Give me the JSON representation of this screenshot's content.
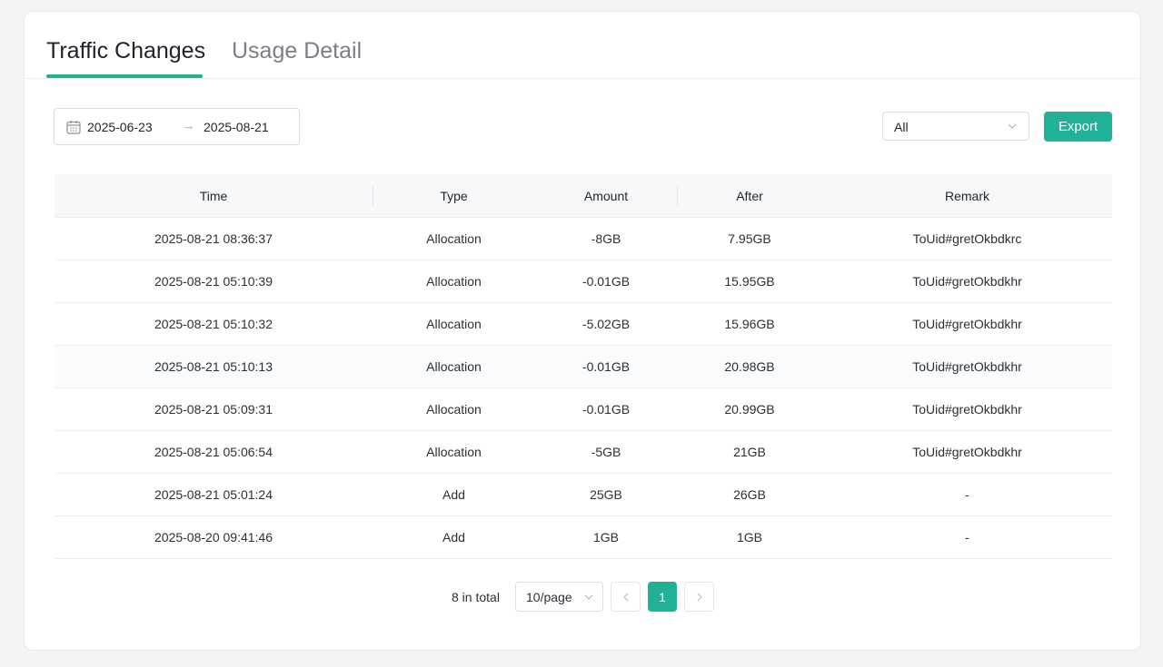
{
  "tabs": [
    {
      "label": "Traffic Changes",
      "active": true
    },
    {
      "label": "Usage Detail",
      "active": false
    }
  ],
  "filters": {
    "date_start": "2025-06-23",
    "date_arrow": "→",
    "date_end": "2025-08-21",
    "type_select": "All",
    "export_label": "Export",
    "icons": {
      "calendar": "calendar-icon",
      "dropdown": "chevron-down-icon"
    }
  },
  "table": {
    "columns": [
      "Time",
      "Type",
      "Amount",
      "After",
      "Remark"
    ],
    "rows": [
      {
        "time": "2025-08-21 08:36:37",
        "type": "Allocation",
        "amount": "-8GB",
        "after": "7.95GB",
        "remark": "ToUid#gretOkbdkrc"
      },
      {
        "time": "2025-08-21 05:10:39",
        "type": "Allocation",
        "amount": "-0.01GB",
        "after": "15.95GB",
        "remark": "ToUid#gretOkbdkhr"
      },
      {
        "time": "2025-08-21 05:10:32",
        "type": "Allocation",
        "amount": "-5.02GB",
        "after": "15.96GB",
        "remark": "ToUid#gretOkbdkhr"
      },
      {
        "time": "2025-08-21 05:10:13",
        "type": "Allocation",
        "amount": "-0.01GB",
        "after": "20.98GB",
        "remark": "ToUid#gretOkbdkhr"
      },
      {
        "time": "2025-08-21 05:09:31",
        "type": "Allocation",
        "amount": "-0.01GB",
        "after": "20.99GB",
        "remark": "ToUid#gretOkbdkhr"
      },
      {
        "time": "2025-08-21 05:06:54",
        "type": "Allocation",
        "amount": "-5GB",
        "after": "21GB",
        "remark": "ToUid#gretOkbdkhr"
      },
      {
        "time": "2025-08-21 05:01:24",
        "type": "Add",
        "amount": "25GB",
        "after": "26GB",
        "remark": "-"
      },
      {
        "time": "2025-08-20 09:41:46",
        "type": "Add",
        "amount": "1GB",
        "after": "1GB",
        "remark": "-"
      }
    ]
  },
  "pagination": {
    "total_text": "8 in total",
    "page_size": "10/page",
    "current_page": "1",
    "icons": {
      "prev": "chevron-left-icon",
      "next": "chevron-right-icon"
    }
  },
  "colors": {
    "accent": "#20b196",
    "background": "#f3f4f6",
    "header_bg": "#f7f8fa"
  }
}
